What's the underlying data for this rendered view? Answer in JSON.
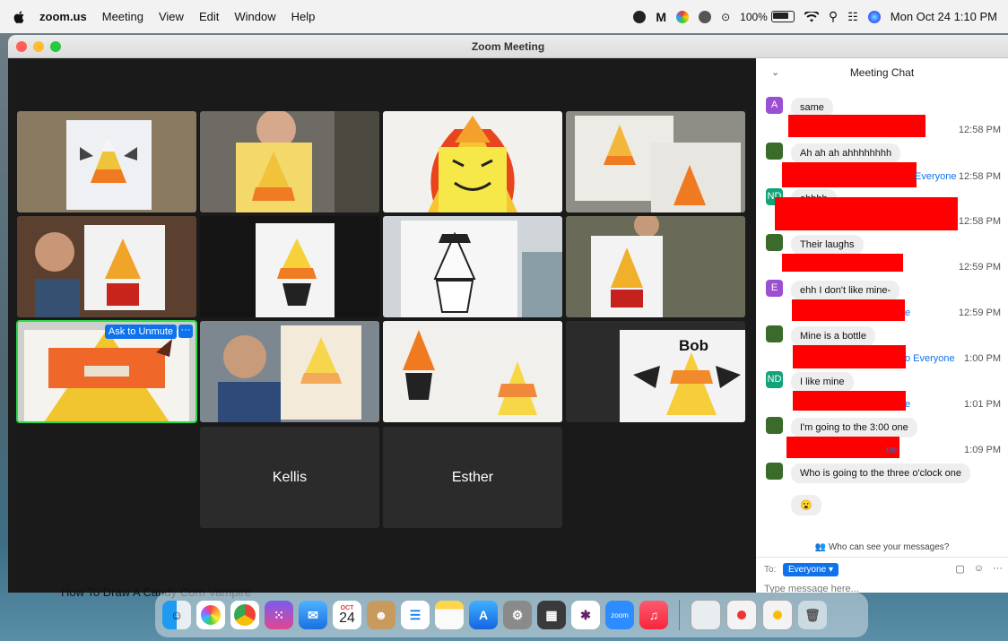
{
  "menubar": {
    "app": "zoom.us",
    "items": [
      "Meeting",
      "View",
      "Edit",
      "Window",
      "Help"
    ],
    "battery": "100%",
    "clock": "Mon Oct 24  1:10 PM"
  },
  "window": {
    "title": "Zoom Meeting"
  },
  "gallery": {
    "active_tile": {
      "unmute_label": "Ask to Unmute",
      "more_label": "···"
    },
    "name_tiles": [
      "Kellis",
      "Esther"
    ],
    "drawing_labels": [
      "Bob"
    ]
  },
  "chat": {
    "title": "Meeting Chat",
    "messages": [
      {
        "initial": "A",
        "avatar_color": "#9b4fd1",
        "text": "same",
        "time": "12:58 PM"
      },
      {
        "initial": "",
        "avatar_color": "#3b6b2a",
        "text": "Ah ah ah ahhhhhhhh",
        "time": "12:58 PM",
        "to": "Everyone"
      },
      {
        "initial": "ND",
        "avatar_color": "#12a37a",
        "text": "ahhhh",
        "time": "12:58 PM"
      },
      {
        "initial": "",
        "avatar_color": "#3b6b2a",
        "text": "Their laughs",
        "time": "12:59 PM"
      },
      {
        "initial": "E",
        "avatar_color": "#9b4fd1",
        "text": "ehh I don't like mine-",
        "time": "12:59 PM",
        "to": "e"
      },
      {
        "initial": "",
        "avatar_color": "#3b6b2a",
        "text": "Mine is a bottle",
        "time": "1:00 PM",
        "to": "o Everyone"
      },
      {
        "initial": "ND",
        "avatar_color": "#12a37a",
        "text": "I like mine",
        "time": "1:01 PM",
        "to": "e"
      },
      {
        "initial": "",
        "avatar_color": "#3b6b2a",
        "text": "I'm going to the 3:00 one",
        "time": "1:09 PM",
        "to": "ne"
      },
      {
        "initial": "",
        "avatar_color": "#3b6b2a",
        "text": "Who is going to the three o'clock one",
        "time": ""
      },
      {
        "initial": "",
        "avatar_color": "",
        "text": "😮",
        "time": ""
      }
    ],
    "who_can_see": "Who can see your messages?",
    "to_label": "To:",
    "recipient": "Everyone ▾",
    "placeholder": "Type message here..."
  },
  "background_text": "How To Draw A Candy Corn Vampire",
  "dock": {
    "calendar_month": "OCT",
    "calendar_day": "24",
    "zoom_label": "zoom"
  }
}
